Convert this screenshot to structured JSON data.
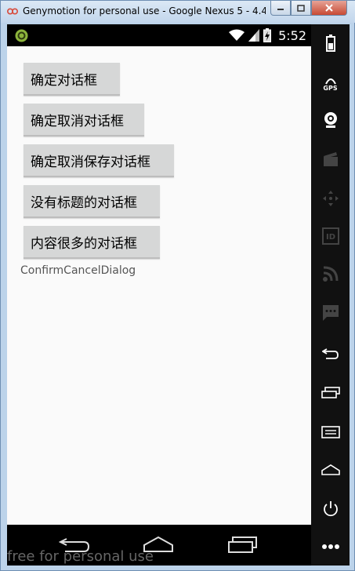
{
  "window": {
    "title": "Genymotion for personal use - Google Nexus 5 - 4.4."
  },
  "statusbar": {
    "time": "5:52"
  },
  "app": {
    "buttons": [
      {
        "label": "确定对话框"
      },
      {
        "label": "确定取消对话框"
      },
      {
        "label": "确定取消保存对话框"
      },
      {
        "label": "没有标题的对话框"
      },
      {
        "label": "内容很多的对话框"
      }
    ],
    "tag_text": "ConfirmCancelDialog"
  },
  "sidebar": {
    "gps_label": "GPS",
    "id_label": "ID"
  },
  "watermark": "free for personal use",
  "icons": [
    "app-icon",
    "genymotion-icon",
    "wifi-icon",
    "signal-icon",
    "battery-icon",
    "back-icon",
    "home-icon",
    "recents-icon",
    "power-icon",
    "menu-icon",
    "camera-icon",
    "clapper-icon",
    "move-icon",
    "rss-icon",
    "chat-icon"
  ]
}
